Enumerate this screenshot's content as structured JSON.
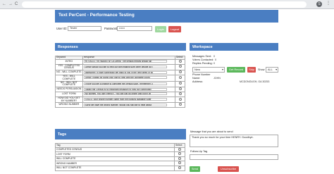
{
  "browser": {
    "back": "←",
    "forward": "→",
    "reload": "C",
    "avatar": "S",
    "menu": "⋮"
  },
  "app": {
    "title": "Text PerCent - Performance Testing"
  },
  "login": {
    "userid_label": "User ID:",
    "userid_value": "Tester",
    "password_label": "Password",
    "password_value": "••••••",
    "login_button": "Login",
    "logout_button": "Logout"
  },
  "responses": {
    "title": "Responses",
    "columns": [
      "Keyword",
      "Response",
      "Select"
    ],
    "rows": [
      {
        "keyword": "INTRO",
        "response": "Hi {TAG1}, I'm {NAME} w/ CA Dems. The census means critical fun"
      },
      {
        "keyword": "YES - COMPLETED CENSUS",
        "response": "Great! Would you like to help out with making sure other people do t"
      },
      {
        "keyword": "NO - WILL COMPLETE",
        "response": "Awesome! I'll have somebody get back to you in the next week or so"
      },
      {
        "keyword": "YES - WILL COMPLETE",
        "response": "Great! Thanks for doing your part to help with the complete count."
      },
      {
        "keyword": "NO - WILL NOT COMPLETE",
        "response": "I hope you get a chance to complete the census soon. Remember, c"
      },
      {
        "keyword": "NEEDS PERSUASION",
        "response": "Taking the Census is so important because it's how our community"
      },
      {
        "keyword": "LOST FORM",
        "response": "No worries. You don't need it - You can just go online and put in yo"
      },
      {
        "keyword": "HOW DID YOU GET MY NUMBER?",
        "response": "{TAG1}, your phone number came from the publicly available voter"
      },
      {
        "keyword": "WRONG NUMBER",
        "response": "Sorry we have the wrong number. Would you still like to hear about"
      }
    ]
  },
  "workspace": {
    "title": "Workspace",
    "messages_sent_label": "Messages Sent:",
    "messages_sent_value": "0",
    "voters_contacted_label": "Voters Contacted:",
    "voters_contacted_value": "0",
    "replies_pending_label": "Replies Pending:",
    "replies_pending_value": "0",
    "phone_label": "Phone Number",
    "phone_value": "",
    "name_label": "Name:",
    "name_value": "JOHN",
    "address_label": "Address:",
    "address_value": "MCDONOUGH, GA  30253",
    "new_select": "New",
    "get_record_button": "Get Record",
    "skip_button": "Skip",
    "show_label": "Show",
    "show_select": "ALL"
  },
  "tags": {
    "title": "Tags",
    "columns": [
      "Tag",
      "Select"
    ],
    "rows": [
      "COMPLETED CENSUS",
      "LOST FORM",
      "WILL COMPLETE",
      "WRONG NUMBER",
      "WILL NOT COMPLETE"
    ]
  },
  "compose": {
    "message_label": "Message that you are about to send",
    "message_value": "Thank you so much for your time HENRY. Goodbye.",
    "followup_label": "Follow-Up Tag",
    "followup_value": "",
    "send_button": "Send",
    "unsubscribe_button": "Unsubscribe"
  },
  "colors": {
    "header_blue": "#4a7ec2",
    "green": "#5cb85c",
    "red": "#d9534f"
  }
}
